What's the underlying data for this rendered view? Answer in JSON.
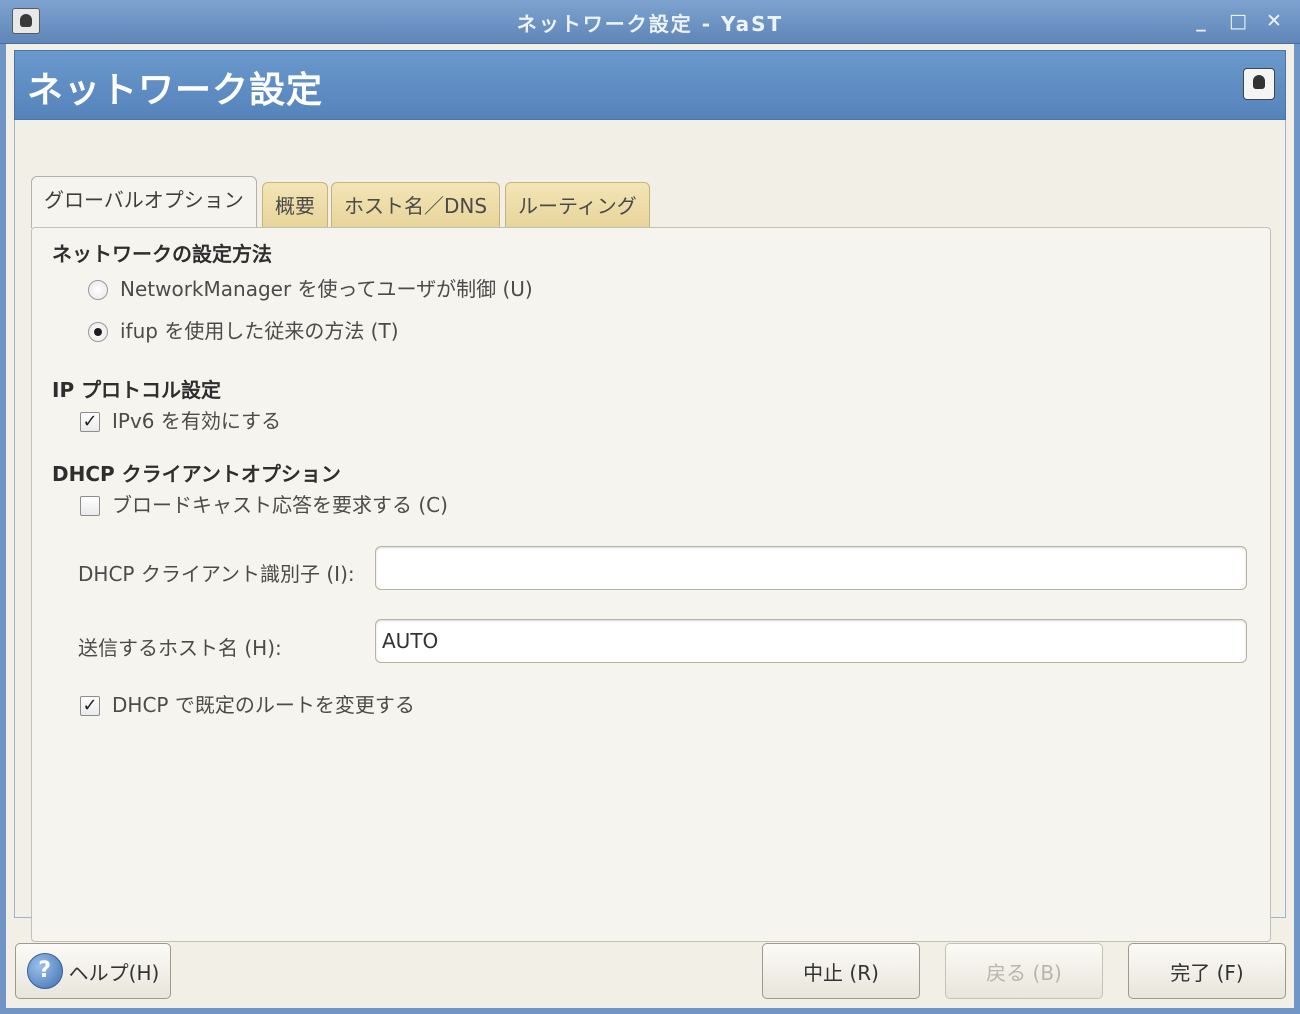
{
  "window": {
    "title": "ネットワーク設定 - YaST",
    "minimize_glyph": "_",
    "maximize_glyph": "□",
    "close_glyph": "✕"
  },
  "banner": {
    "heading": "ネットワーク設定",
    "help_icon": "yast-help-icon"
  },
  "tabs": [
    {
      "label": "グローバルオプション",
      "active": true
    },
    {
      "label": "概要",
      "active": false
    },
    {
      "label": "ホスト名／DNS",
      "active": false
    },
    {
      "label": "ルーティング",
      "active": false
    }
  ],
  "network_setup": {
    "title": "ネットワークの設定方法",
    "option_networkmanager": "NetworkManager を使ってユーザが制御 (U)",
    "option_ifup": "ifup を使用した従来の方法 (T)",
    "selected": "ifup"
  },
  "ip_protocol": {
    "title": "IP プロトコル設定",
    "ipv6_label": "IPv6 を有効にする",
    "ipv6_checked": true
  },
  "dhcp": {
    "title": "DHCP クライアントオプション",
    "broadcast_label": "ブロードキャスト応答を要求する (C)",
    "broadcast_checked": false,
    "client_id_label": "DHCP クライアント識別子 (I):",
    "client_id_value": "",
    "hostname_label": "送信するホスト名 (H):",
    "hostname_value": "AUTO",
    "default_route_label": "DHCP で既定のルートを変更する",
    "default_route_checked": true
  },
  "buttons": {
    "help": "ヘルプ(H)",
    "abort": "中止 (R)",
    "back": "戻る (B)",
    "finish": "完了 (F)"
  }
}
